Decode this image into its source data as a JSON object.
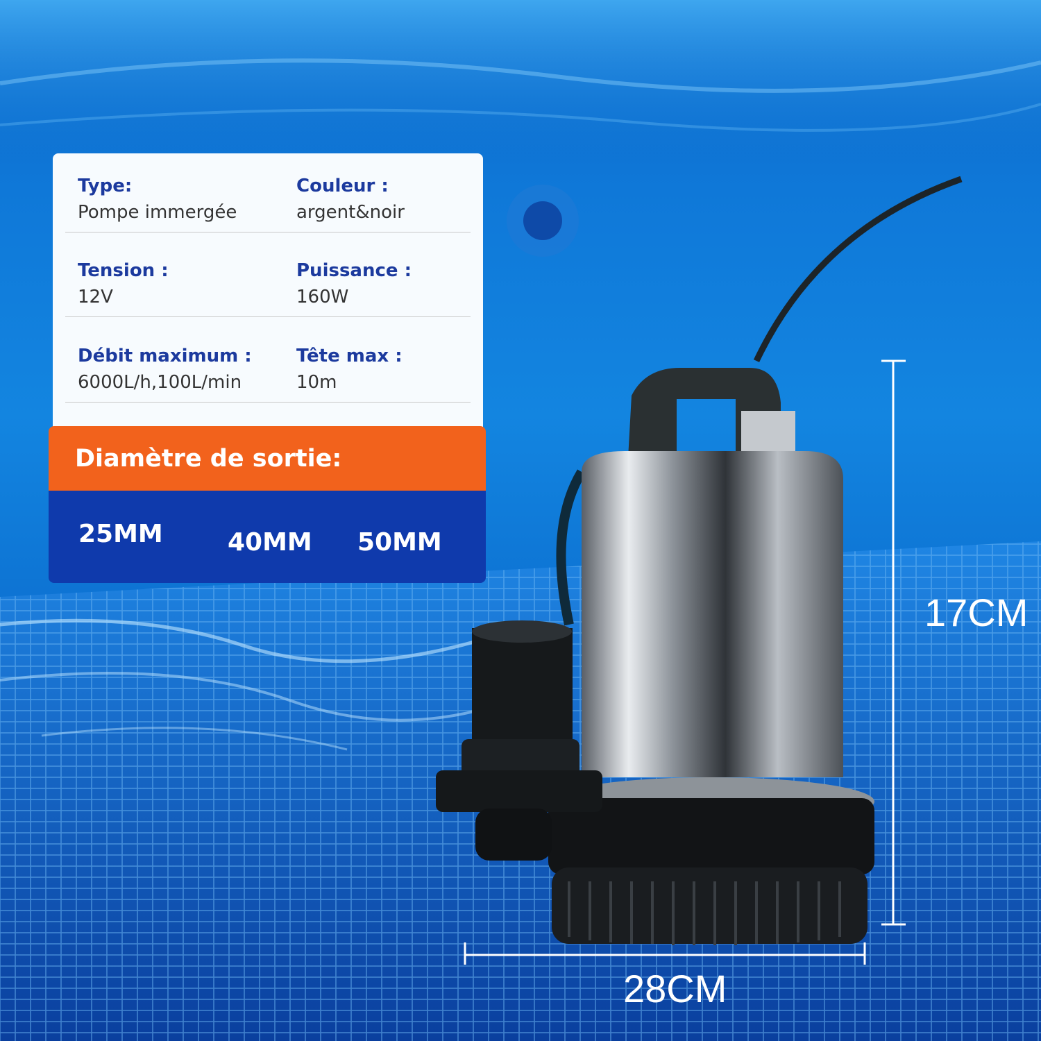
{
  "specs": {
    "rows": [
      [
        {
          "label": "Type:",
          "value": "Pompe immergée"
        },
        {
          "label": "Couleur :",
          "value": "argent&noir"
        }
      ],
      [
        {
          "label": "Tension :",
          "value": "12V"
        },
        {
          "label": "Puissance :",
          "value": " 160W"
        }
      ],
      [
        {
          "label": "Débit maximum :",
          "value": "6000L/h,100L/min"
        },
        {
          "label": "Tête max :",
          "value": " 10m"
        }
      ]
    ]
  },
  "outlet": {
    "title": "Diamètre de sortie:",
    "sizes": [
      "25MM",
      "40MM",
      "50MM"
    ]
  },
  "dimensions": {
    "height": "17CM",
    "width": "28CM"
  },
  "colors": {
    "label_blue": "#1c3a9e",
    "orange": "#f2621c",
    "navy": "#0f3aac",
    "water": "#1385e0"
  },
  "icons": [
    "pool-light-icon",
    "submersible-pump-icon"
  ]
}
